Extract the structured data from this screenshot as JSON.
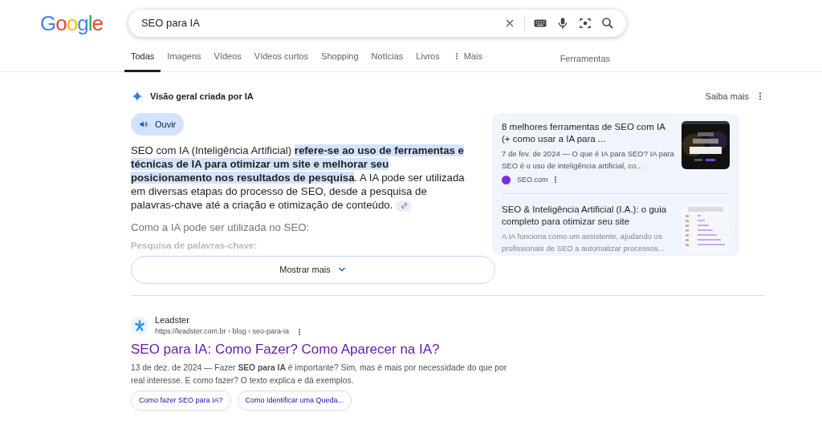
{
  "logo": "Google",
  "search": {
    "value": "SEO para IA"
  },
  "tabs": [
    {
      "label": "Todas",
      "selected": true
    },
    {
      "label": "Imagens",
      "selected": false
    },
    {
      "label": "Vídeos",
      "selected": false
    },
    {
      "label": "Vídeos curtos",
      "selected": false
    },
    {
      "label": "Shopping",
      "selected": false
    },
    {
      "label": "Notícias",
      "selected": false
    },
    {
      "label": "Livros",
      "selected": false
    },
    {
      "label": "Mais",
      "selected": false,
      "kind": "more"
    }
  ],
  "tools": "Ferramentas",
  "overview": {
    "title": "Visão geral criada por IA",
    "learn_more": "Saiba mais",
    "listen": "Ouvir",
    "paragraph": [
      {
        "text": "SEO com IA (Inteligência Artificial) ",
        "highlighted": false
      },
      {
        "text": "refere-se ao uso de ferramentas e técnicas de IA para otimizar um site e melhorar seu posicionamento nos resultados de pesquisa",
        "highlighted": true
      },
      {
        "text": ". A IA pode ser utilizada em diversas etapas do processo de SEO, desde a pesquisa de palavras-chave até a criação e otimização de conteúdo.",
        "highlighted": false
      }
    ],
    "subheading": "Como a IA pode ser utilizada no SEO:",
    "faded_item": "Pesquisa de palavras-chave:",
    "show_more": "Mostrar mais",
    "sources": [
      {
        "title": "8 melhores ferramentas de SEO com IA (+ como usar a IA para ...",
        "snippet": "7 de fev. de 2024 — O que é IA para SEO? IA para SEO é o uso de inteligência artificial, co...",
        "site": "SEO.com",
        "faded": false,
        "kind": "picture"
      },
      {
        "title": "SEO & Inteligência Artificial (I.A.): o guia completo para otimizar seu site",
        "snippet": "A IA funciona como um assistente, ajudando os profissionais de SEO a automatizar processos...",
        "faded": true,
        "kind": "picture"
      }
    ]
  },
  "results": [
    {
      "site": "Leadster",
      "url": "https://leadster.com.br › blog › seo-para-ia",
      "title": "SEO para IA: Como Fazer? Como Aparecer na IA?",
      "snippet": "13 de dez. de 2024 — Fazer **SEO para IA** é importante? Sim, mas é mais por necessidade do que por real interesse. E como fazer? O texto explica e dá exemplos.",
      "chips": [
        "Como fazer SEO para IA?",
        "Como Identificar uma Queda..."
      ]
    }
  ]
}
